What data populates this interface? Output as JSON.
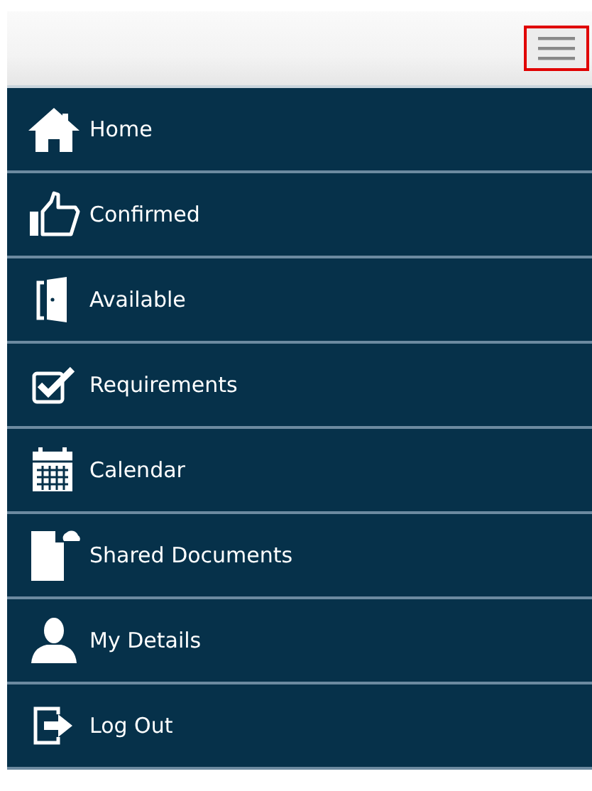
{
  "header": {
    "menu_button": {
      "highlighted": true
    }
  },
  "menu": [
    {
      "kind": "home",
      "label": "Home"
    },
    {
      "kind": "thumbs-up",
      "label": "Confirmed"
    },
    {
      "kind": "door",
      "label": "Available"
    },
    {
      "kind": "checkbox",
      "label": "Requirements"
    },
    {
      "kind": "calendar",
      "label": "Calendar"
    },
    {
      "kind": "document",
      "label": "Shared Documents"
    },
    {
      "kind": "person",
      "label": "My Details"
    },
    {
      "kind": "logout",
      "label": "Log Out"
    }
  ]
}
